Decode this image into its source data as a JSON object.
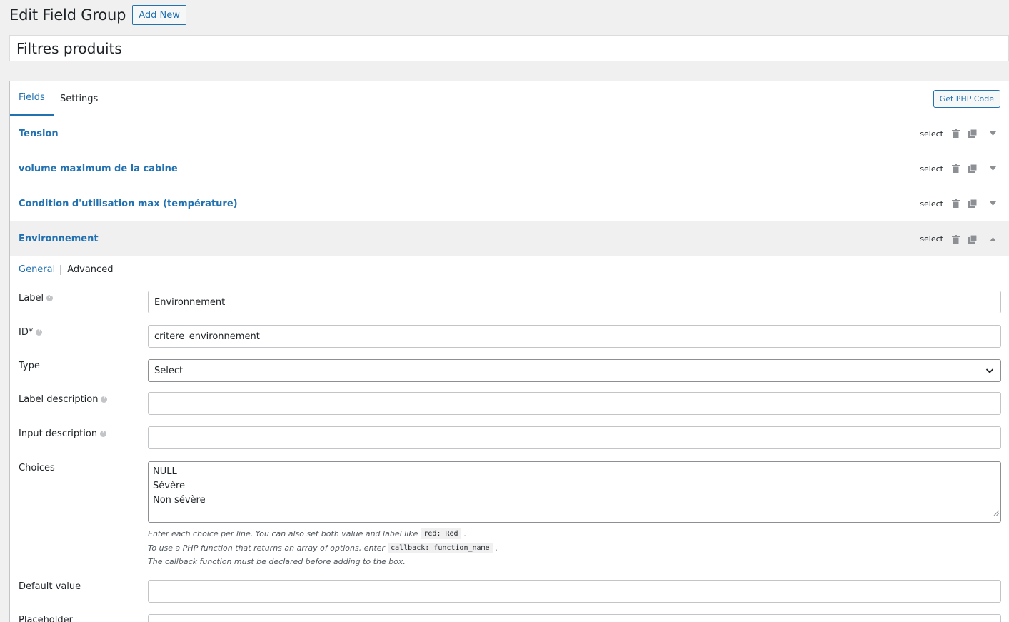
{
  "header": {
    "title": "Edit Field Group",
    "add_new": "Add New"
  },
  "group_title": "Filtres produits",
  "tabs": {
    "fields": "Fields",
    "settings": "Settings"
  },
  "get_php_code": "Get PHP Code",
  "fields": [
    {
      "name": "Tension",
      "type": "select"
    },
    {
      "name": "volume maximum de la cabine",
      "type": "select"
    },
    {
      "name": "Condition d'utilisation max (température)",
      "type": "select"
    },
    {
      "name": "Environnement",
      "type": "select"
    }
  ],
  "subtabs": {
    "general": "General",
    "advanced": "Advanced"
  },
  "form": {
    "label": {
      "label": "Label",
      "value": "Environnement"
    },
    "id": {
      "label": "ID*",
      "value": "critere_environnement"
    },
    "type": {
      "label": "Type",
      "value": "Select"
    },
    "label_description": {
      "label": "Label description",
      "value": ""
    },
    "input_description": {
      "label": "Input description",
      "value": ""
    },
    "choices": {
      "label": "Choices",
      "lines": [
        "NULL",
        "Sévère",
        "Non sévère"
      ]
    },
    "choices_hint": {
      "line1_pre": "Enter each choice per line. You can also set both value and label like",
      "line1_code": "red: Red",
      "line1_post": ".",
      "line2_pre": "To use a PHP function that returns an array of options, enter",
      "line2_code": "callback: function_name",
      "line2_post": ".",
      "line3": "The callback function must be declared before adding to the box."
    },
    "default_value": {
      "label": "Default value",
      "value": ""
    },
    "placeholder": {
      "label": "Placeholder",
      "value": ""
    }
  },
  "icons": {
    "delete": "trash-icon",
    "duplicate": "duplicate-icon",
    "toggle_closed": "triangle-down-icon",
    "toggle_open": "triangle-up-icon"
  },
  "colors": {
    "accent": "#2271b1",
    "background": "#f0f0f1"
  }
}
